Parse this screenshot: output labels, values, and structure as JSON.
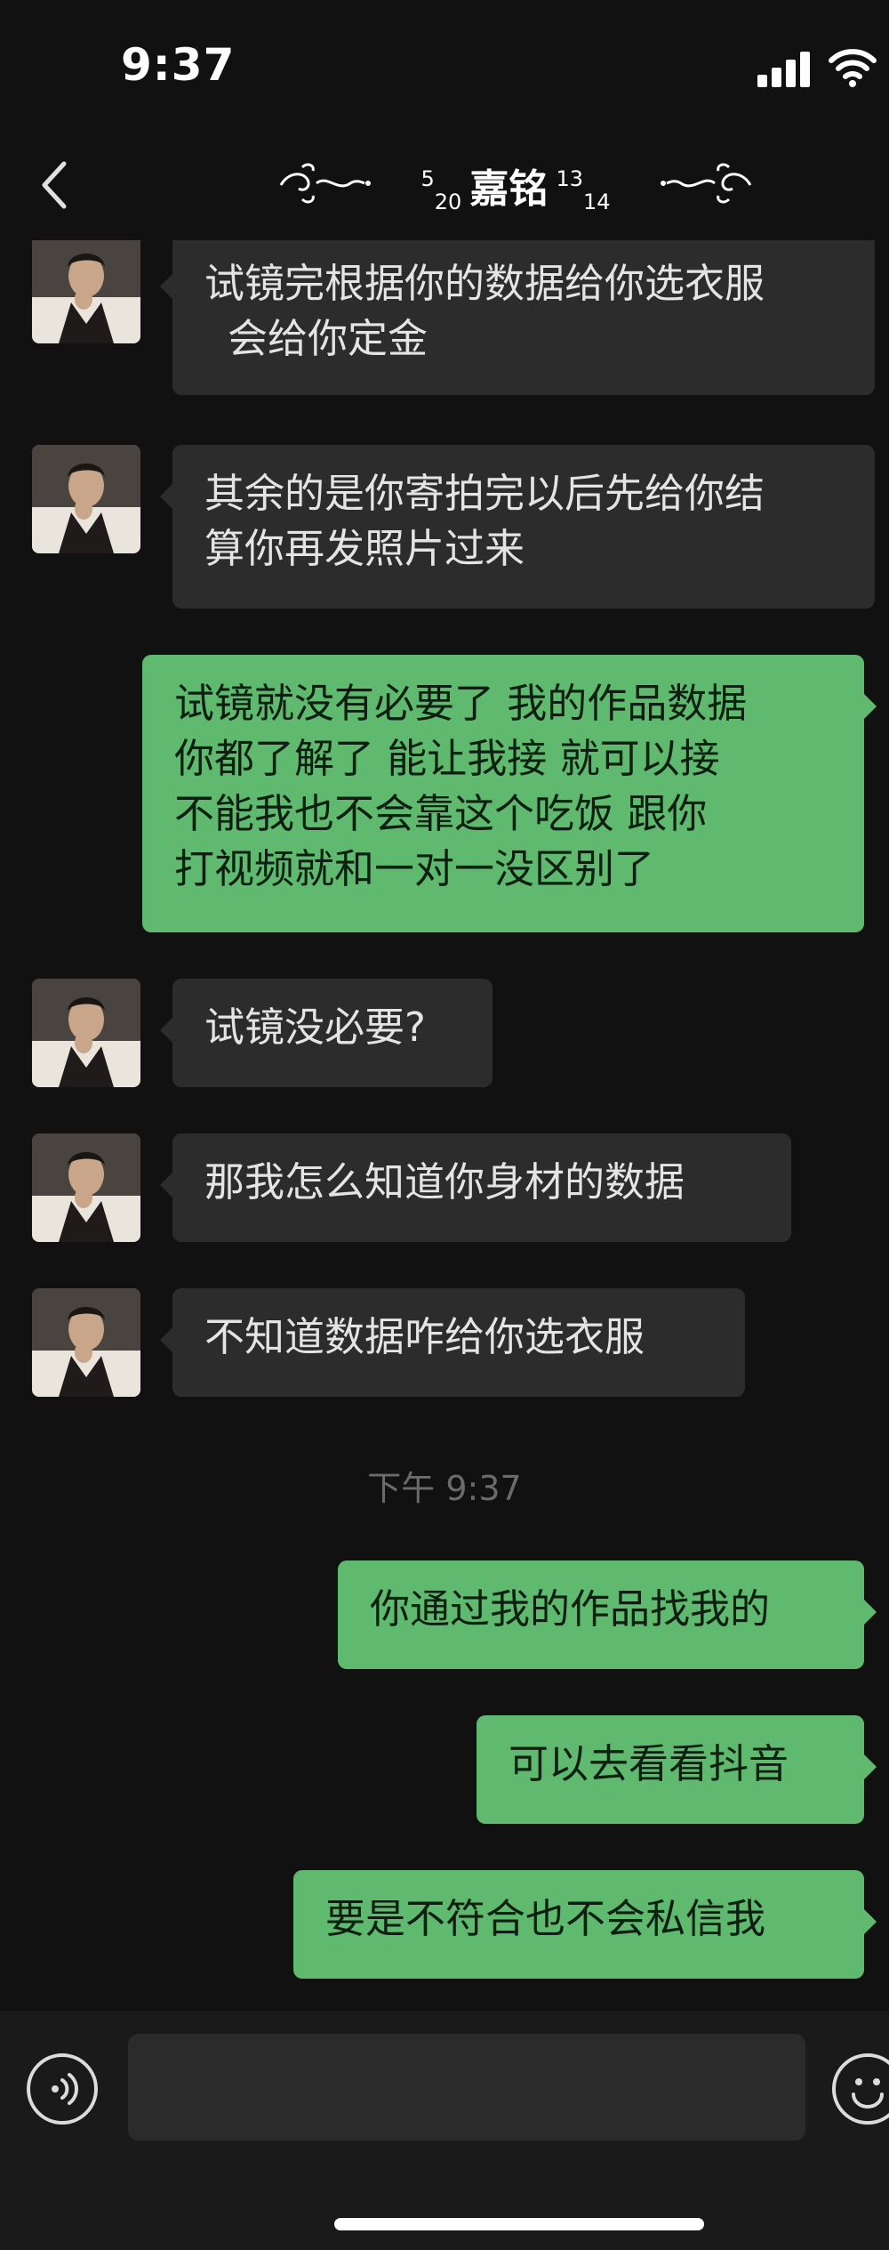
{
  "status_bar": {
    "time": "9:37"
  },
  "header": {
    "title": "嘉铭",
    "sup_left_top": "5",
    "sup_left_bottom": "20",
    "sup_right_top": "13",
    "sup_right_bottom": "14"
  },
  "messages": [
    {
      "side": "in",
      "lines": [
        "试镜完根据你的数据给你选衣服",
        "会给你定金"
      ]
    },
    {
      "side": "in",
      "lines": [
        "其余的是你寄拍完以后先给你结",
        "算你再发照片过来"
      ]
    },
    {
      "side": "out",
      "lines": [
        "试镜就没有必要了 我的作品数据",
        "你都了解了 能让我接 就可以接",
        "不能我也不会靠这个吃饭 跟你",
        "打视频就和一对一没区别了"
      ]
    },
    {
      "side": "in",
      "lines": [
        "试镜没必要?"
      ]
    },
    {
      "side": "in",
      "lines": [
        "那我怎么知道你身材的数据"
      ]
    },
    {
      "side": "in",
      "lines": [
        "不知道数据咋给你选衣服"
      ]
    },
    {
      "side": "out",
      "lines": [
        "你通过我的作品找我的"
      ]
    },
    {
      "side": "out",
      "lines": [
        "可以去看看抖音"
      ]
    },
    {
      "side": "out",
      "lines": [
        "要是不符合也不会私信我"
      ]
    }
  ],
  "timestamp": "下午 9:37",
  "input": {
    "placeholder": ""
  },
  "colors": {
    "incoming_bubble": "#2c2c2c",
    "outgoing_bubble": "#5fba6f",
    "background": "#111111"
  },
  "icons": [
    "signal-icon",
    "wifi-icon",
    "back-icon",
    "voice-icon",
    "emoji-icon"
  ]
}
